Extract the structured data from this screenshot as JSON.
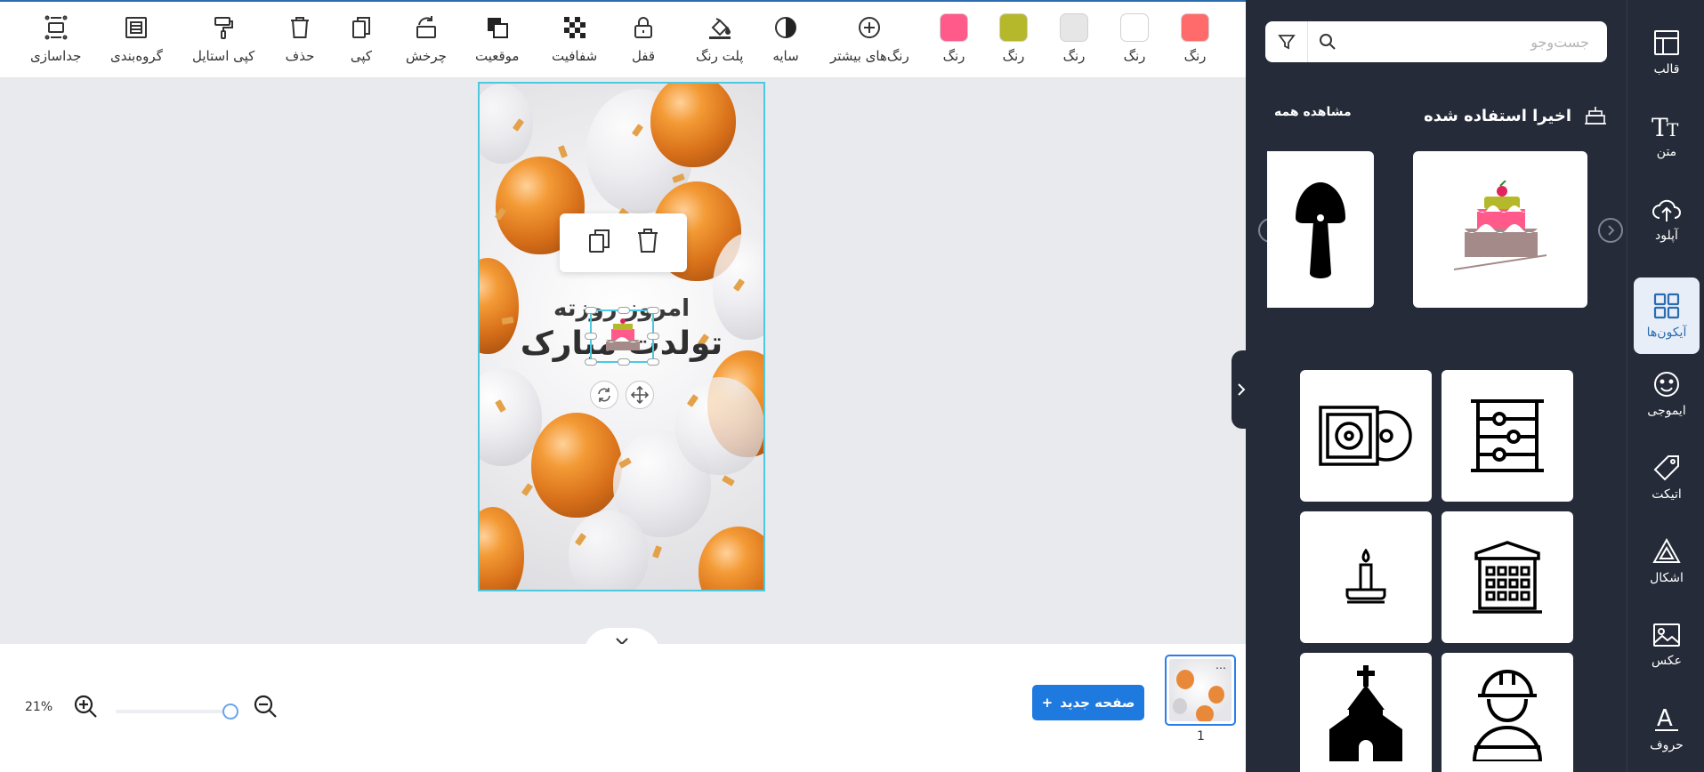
{
  "toolbar": {
    "items": [
      {
        "label": "جداسازی",
        "icon": "ungroup-icon"
      },
      {
        "label": "گروه‌بندی",
        "icon": "group-icon"
      },
      {
        "label": "کپی استایل",
        "icon": "paint-roller-icon"
      },
      {
        "label": "حذف",
        "icon": "trash-icon"
      },
      {
        "label": "کپی",
        "icon": "copy-icon"
      },
      {
        "label": "چرخش",
        "icon": "rotate-icon"
      },
      {
        "label": "موقعیت",
        "icon": "layers-position-icon"
      },
      {
        "label": "شفافیت",
        "icon": "transparency-icon"
      },
      {
        "label": "قفل",
        "icon": "lock-icon"
      },
      {
        "label": "پلت رنگ",
        "icon": "paint-bucket-icon"
      },
      {
        "label": "سایه",
        "icon": "shadow-icon"
      },
      {
        "label": "رنگ‌های بیشتر",
        "icon": "plus-circle-icon"
      }
    ],
    "swatches": [
      {
        "label": "رنگ",
        "color": "#ff5a8a"
      },
      {
        "label": "رنگ",
        "color": "#b5b82a"
      },
      {
        "label": "رنگ",
        "color": "#e6e6e6"
      },
      {
        "label": "رنگ",
        "color": "#ffffff"
      },
      {
        "label": "رنگ",
        "color": "#ff6b6b"
      }
    ]
  },
  "artboard": {
    "line1": "امروز روزته",
    "line2": "تولدت مبارک"
  },
  "bottombar": {
    "zoom": "21%",
    "new_page_label": "صفحه جدید",
    "page_number": "1",
    "thumb_menu": "…"
  },
  "panel": {
    "search_placeholder": "جست‌وجو",
    "recent_title": "اخیرا استفاده شده",
    "see_all": "مشاهده همه"
  },
  "nav": {
    "items": [
      {
        "label": "قالب",
        "icon": "template-icon"
      },
      {
        "label": "متن",
        "icon": "text-icon"
      },
      {
        "label": "آپلود",
        "icon": "upload-icon"
      },
      {
        "label": "آیکون‌ها",
        "icon": "icons-grid-icon",
        "active": true
      },
      {
        "label": "ایموجی",
        "icon": "emoji-icon"
      },
      {
        "label": "اتیکت",
        "icon": "tag-icon"
      },
      {
        "label": "اشکال",
        "icon": "shapes-icon"
      },
      {
        "label": "عکس",
        "icon": "image-icon"
      },
      {
        "label": "حروف",
        "icon": "letters-icon"
      }
    ]
  },
  "colors": {
    "accent": "#1f7ae0",
    "panel_bg": "#252b38",
    "selection": "#4cc9e0"
  }
}
